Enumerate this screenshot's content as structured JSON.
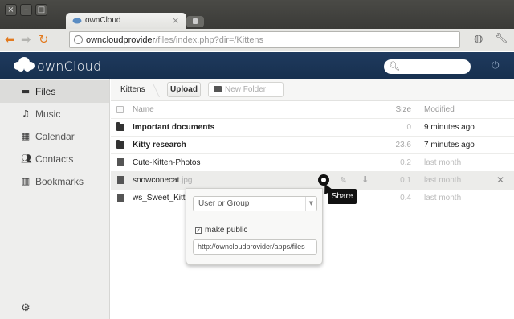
{
  "browser": {
    "window_buttons": [
      "×",
      "–",
      "□"
    ],
    "tab_title": "ownCloud",
    "tab_close": "×",
    "url_host": "owncloudprovider",
    "url_path": "/files/index.php?dir=/Kittens"
  },
  "header": {
    "logo_text": "ownCloud",
    "search_placeholder": ""
  },
  "sidebar": {
    "items": [
      {
        "label": "Files",
        "icon": "files-icon",
        "active": true
      },
      {
        "label": "Music",
        "icon": "music-icon",
        "active": false
      },
      {
        "label": "Calendar",
        "icon": "calendar-icon",
        "active": false
      },
      {
        "label": "Contacts",
        "icon": "contacts-icon",
        "active": false
      },
      {
        "label": "Bookmarks",
        "icon": "bookmarks-icon",
        "active": false
      }
    ]
  },
  "controls": {
    "breadcrumb": "Kittens",
    "upload_label": "Upload",
    "new_folder_label": "New Folder"
  },
  "table": {
    "headers": {
      "name": "Name",
      "size": "Size",
      "modified": "Modified"
    },
    "rows": [
      {
        "type": "folder",
        "name": "Important documents",
        "ext": "",
        "size": "0",
        "modified": "9 minutes ago",
        "bold": true
      },
      {
        "type": "folder",
        "name": "Kitty research",
        "ext": "",
        "size": "23.6",
        "modified": "7 minutes ago",
        "bold": true
      },
      {
        "type": "file",
        "name": "Cute-Kitten-Photos",
        "ext": "",
        "size": "0.2",
        "modified": "last month",
        "bold": false
      },
      {
        "type": "file",
        "name": "snowconecat",
        "ext": ".jpg",
        "size": "0.1",
        "modified": "last month",
        "bold": false
      },
      {
        "type": "file",
        "name": "ws_Sweet_Kitte",
        "ext": "",
        "size": "0.4",
        "modified": "last month",
        "bold": false
      }
    ]
  },
  "tooltip": "Share",
  "share": {
    "select_placeholder": "User or Group",
    "make_public_label": "make public",
    "link_value": "http://owncloudprovider/apps/files"
  },
  "colors": {
    "header_bg": "#1f3a5e",
    "sidebar_bg": "#eeeeed",
    "browser_accent": "#e27a1f"
  }
}
